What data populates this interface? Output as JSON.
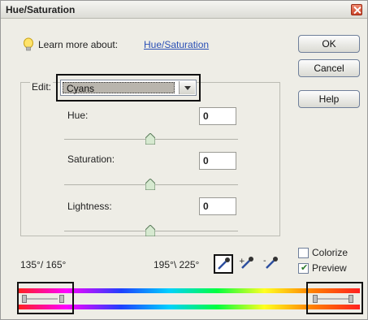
{
  "window": {
    "title": "Hue/Saturation"
  },
  "learn": {
    "label": "Learn more about:",
    "link": "Hue/Saturation"
  },
  "buttons": {
    "ok": "OK",
    "cancel": "Cancel",
    "help": "Help"
  },
  "edit": {
    "label": "Edit:",
    "selected": "Cyans"
  },
  "sliders": [
    {
      "label": "Hue:",
      "value": "0",
      "level": 0.5
    },
    {
      "label": "Saturation:",
      "value": "0",
      "level": 0.5
    },
    {
      "label": "Lightness:",
      "value": "0",
      "level": 0.5
    }
  ],
  "range": {
    "left": "135°/ 165°",
    "right": "195°\\ 225°"
  },
  "checkboxes": {
    "colorize": {
      "label": "Colorize",
      "checked": false
    },
    "preview": {
      "label": "Preview",
      "checked": true
    }
  },
  "icons": {
    "bulb": "lightbulb-icon",
    "eyedroppers": [
      "eyedropper-icon",
      "eyedropper-plus-icon",
      "eyedropper-minus-icon"
    ]
  }
}
